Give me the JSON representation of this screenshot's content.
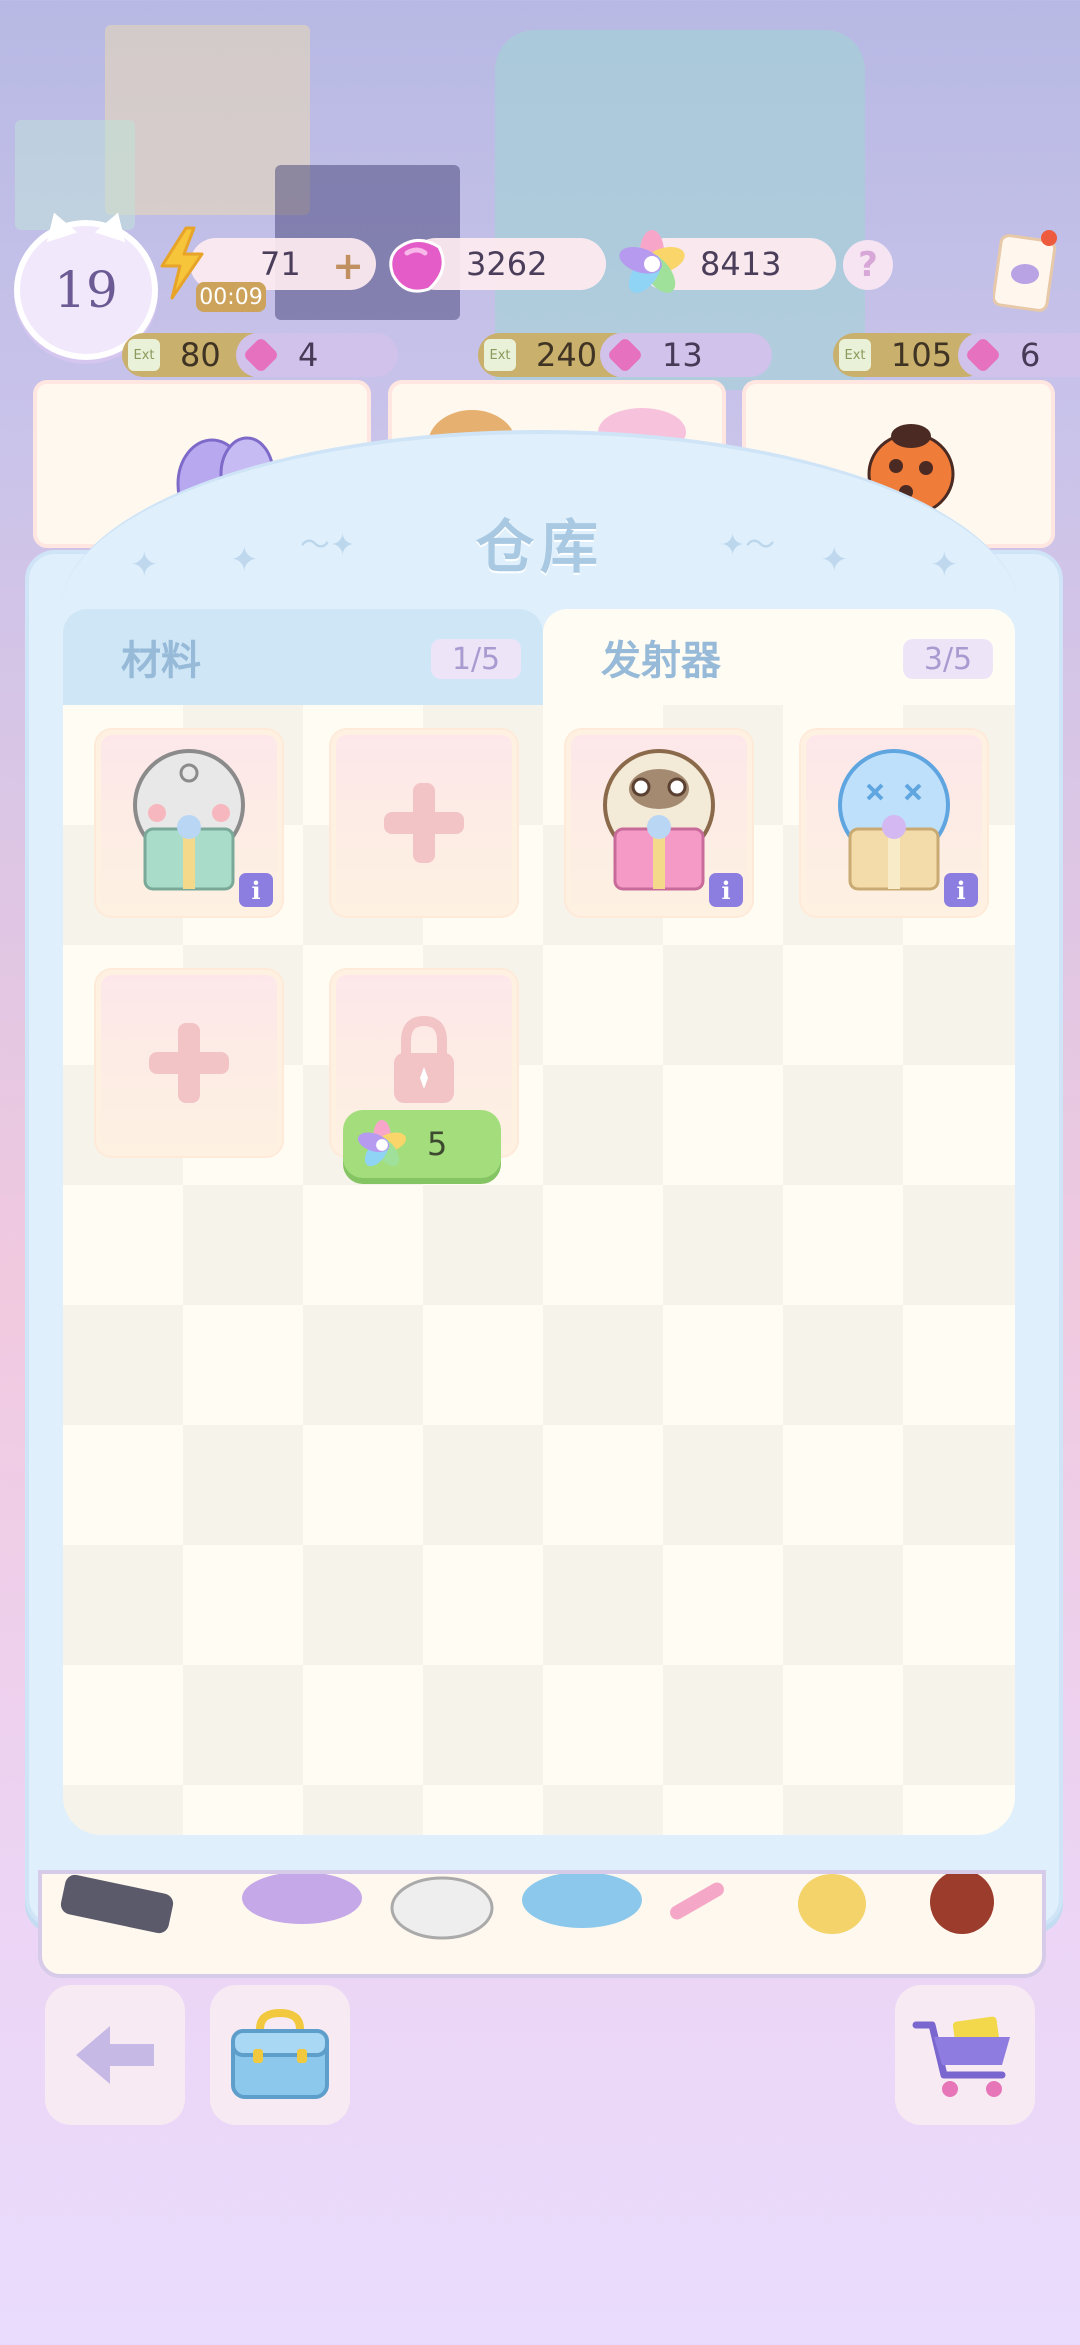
{
  "hud": {
    "level": "19",
    "energy": "71",
    "energy_plus": "+",
    "energy_timer": "00:09",
    "gems": "3262",
    "stars": "8413",
    "help": "?"
  },
  "orders": [
    {
      "ev": "80",
      "gems": "4"
    },
    {
      "ev": "240",
      "gems": "13"
    },
    {
      "ev": "105",
      "gems": "6"
    }
  ],
  "warehouse": {
    "title": "仓库",
    "tabs": [
      {
        "label": "材料",
        "count": "1/5"
      },
      {
        "label": "发射器",
        "count": "3/5"
      }
    ],
    "info_label": "i",
    "unlock_cost": "5"
  },
  "ev_label": "Ext",
  "colors": {
    "panel": "#dff0fc",
    "tab_active": "#fffcf3",
    "tab_inactive": "#cfe6f7",
    "info_badge": "#8c7ee0",
    "unlock_button": "#a3dd7c"
  },
  "icons": [
    "bolt-icon",
    "gem-icon",
    "rainbow-star-icon",
    "help-icon",
    "card-icon",
    "back-arrow-icon",
    "toolbox-icon",
    "cart-icon",
    "lock-icon",
    "plus-icon"
  ]
}
